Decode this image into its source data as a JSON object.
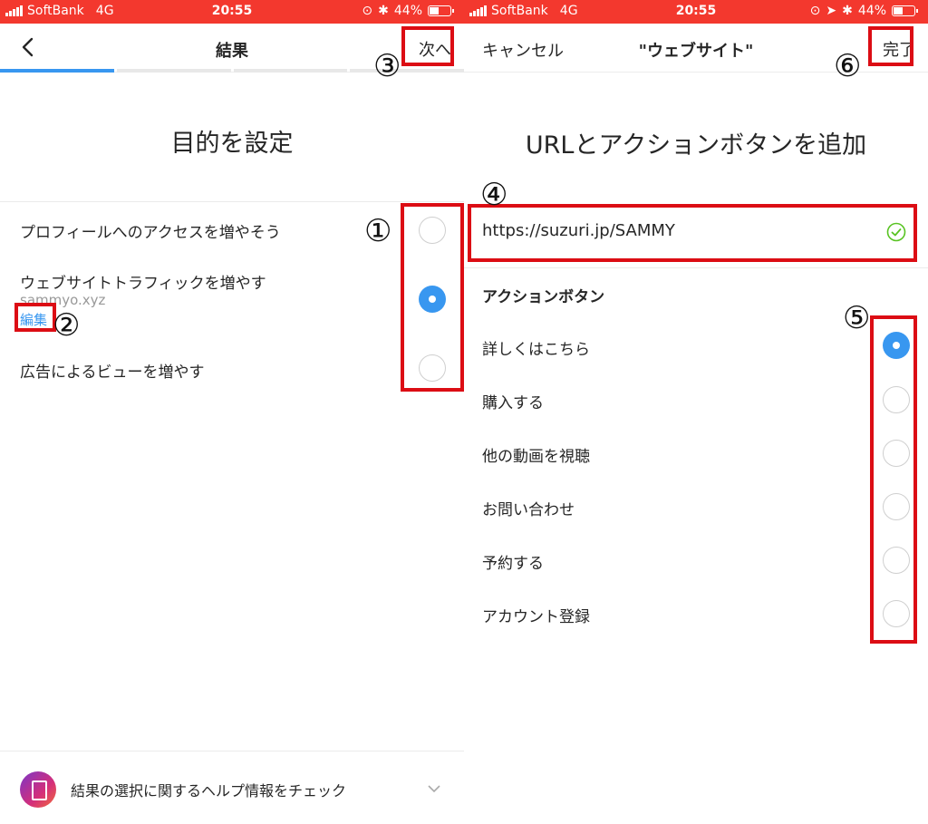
{
  "status_bar": {
    "carrier": "SoftBank",
    "network": "4G",
    "time": "20:55",
    "battery": "44%",
    "battery_level": 0.44
  },
  "left": {
    "nav": {
      "title": "結果",
      "next_label": "次へ"
    },
    "progress": {
      "total_steps": 4,
      "current_step": 1
    },
    "heading": "目的を設定",
    "options": [
      {
        "label": "プロフィールへのアクセスを増やそう",
        "selected": false
      },
      {
        "label": "ウェブサイトトラフィックを増やす",
        "sub": "sammyo.xyz",
        "edit_label": "編集",
        "selected": true
      },
      {
        "label": "広告によるビューを増やす",
        "selected": false
      }
    ],
    "help": {
      "text": "結果の選択に関するヘルプ情報をチェック"
    }
  },
  "right": {
    "nav": {
      "cancel_label": "キャンセル",
      "title": "\"ウェブサイト\"",
      "done_label": "完了"
    },
    "heading": "URLとアクションボタンを追加",
    "url": "https://suzuri.jp/SAMMY",
    "section_title": "アクションボタン",
    "actions": [
      {
        "label": "詳しくはこちら",
        "selected": true
      },
      {
        "label": "購入する",
        "selected": false
      },
      {
        "label": "他の動画を視聴",
        "selected": false
      },
      {
        "label": "お問い合わせ",
        "selected": false
      },
      {
        "label": "予約する",
        "selected": false
      },
      {
        "label": "アカウント登録",
        "selected": false
      }
    ]
  },
  "annotations": {
    "marker_1": "①",
    "marker_2": "②",
    "marker_3": "③",
    "marker_4": "④",
    "marker_5": "⑤",
    "marker_6": "⑥"
  },
  "colors": {
    "status_bar": "#f3382e",
    "accent": "#3897f0",
    "annotation_box": "#dc0d14",
    "check": "#58c322"
  }
}
